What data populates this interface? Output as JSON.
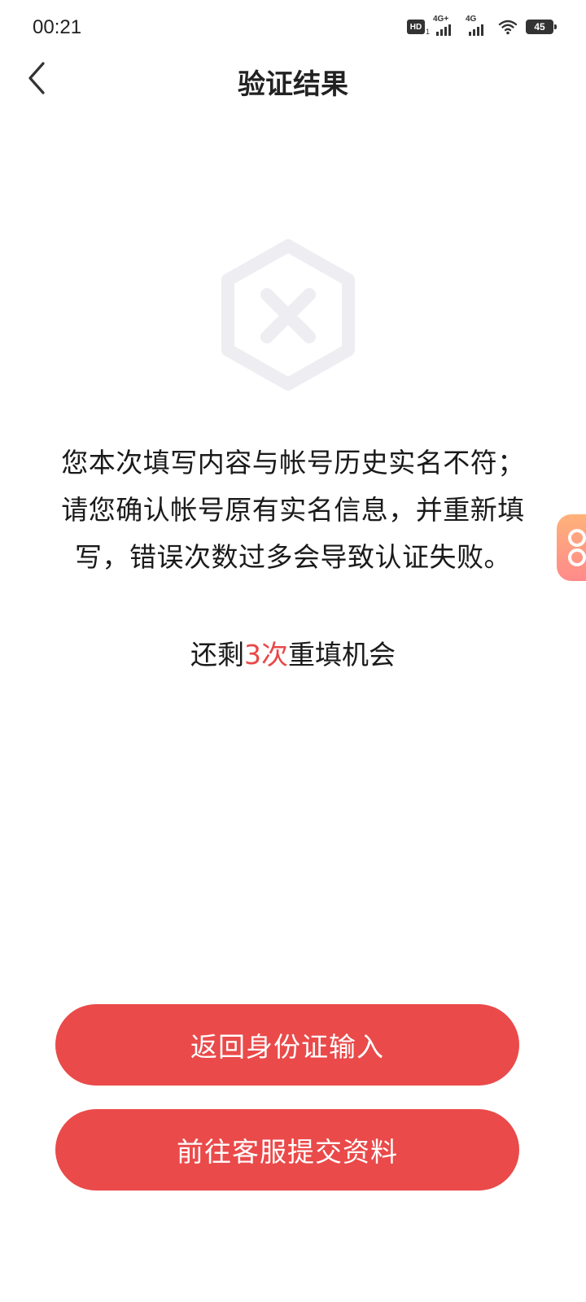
{
  "status_bar": {
    "time": "00:21",
    "hd_label": "HD",
    "hd_sub": "1",
    "signal1_label": "4G+",
    "signal2_label": "4G",
    "battery": "45"
  },
  "nav": {
    "title": "验证结果"
  },
  "message": {
    "lines": [
      "您本次填写内容与帐号历史实名不符；",
      "请您确认帐号原有实名信息，并重新填",
      "写，错误次数过多会导致认证失败。"
    ]
  },
  "remaining": {
    "prefix": "还剩",
    "count": "3次",
    "suffix": "重填机会"
  },
  "buttons": {
    "return_label": "返回身份证输入",
    "service_label": "前往客服提交资料"
  },
  "colors": {
    "accent": "#ea4a4a",
    "highlight": "#e94848",
    "icon_gray": "#eeeef2"
  },
  "icons": {
    "back": "chevron-left-icon",
    "result": "hexagon-x-icon",
    "float": "floating-assistant-icon"
  }
}
